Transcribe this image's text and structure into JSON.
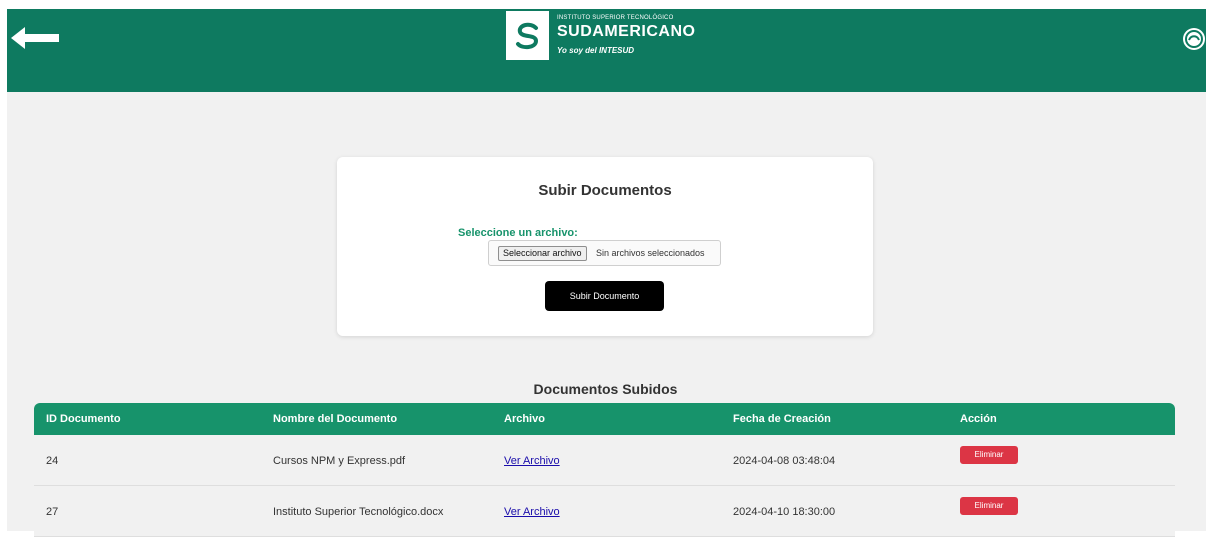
{
  "header": {
    "logo": {
      "small": "INSTITUTO SUPERIOR TECNOLÓGICO",
      "name": "SUDAMERICANO",
      "motto": "Yo soy del INTESUD"
    },
    "icons": {
      "back": "arrow-left-icon",
      "badge": "institution-badge-icon"
    },
    "color": "#0e7a60"
  },
  "upload": {
    "title": "Subir Documentos",
    "file_label": "Seleccione un archivo:",
    "file_button": "Seleccionar archivo",
    "file_status": "Sin archivos seleccionados",
    "submit_label": "Subir Documento"
  },
  "documents": {
    "title": "Documentos Subidos",
    "columns": [
      "ID Documento",
      "Nombre del Documento",
      "Archivo",
      "Fecha de Creación",
      "Acción"
    ],
    "rows": [
      {
        "id": "24",
        "name": "Cursos NPM y Express.pdf",
        "file_link": "Ver Archivo",
        "created": "2024-04-08 03:48:04",
        "action": "Eliminar"
      },
      {
        "id": "27",
        "name": "Instituto Superior Tecnológico.docx",
        "file_link": "Ver Archivo",
        "created": "2024-04-10 18:30:00",
        "action": "Eliminar"
      }
    ]
  },
  "colors": {
    "accent": "#17936b",
    "danger": "#dc3545",
    "button_dark": "#000000"
  }
}
